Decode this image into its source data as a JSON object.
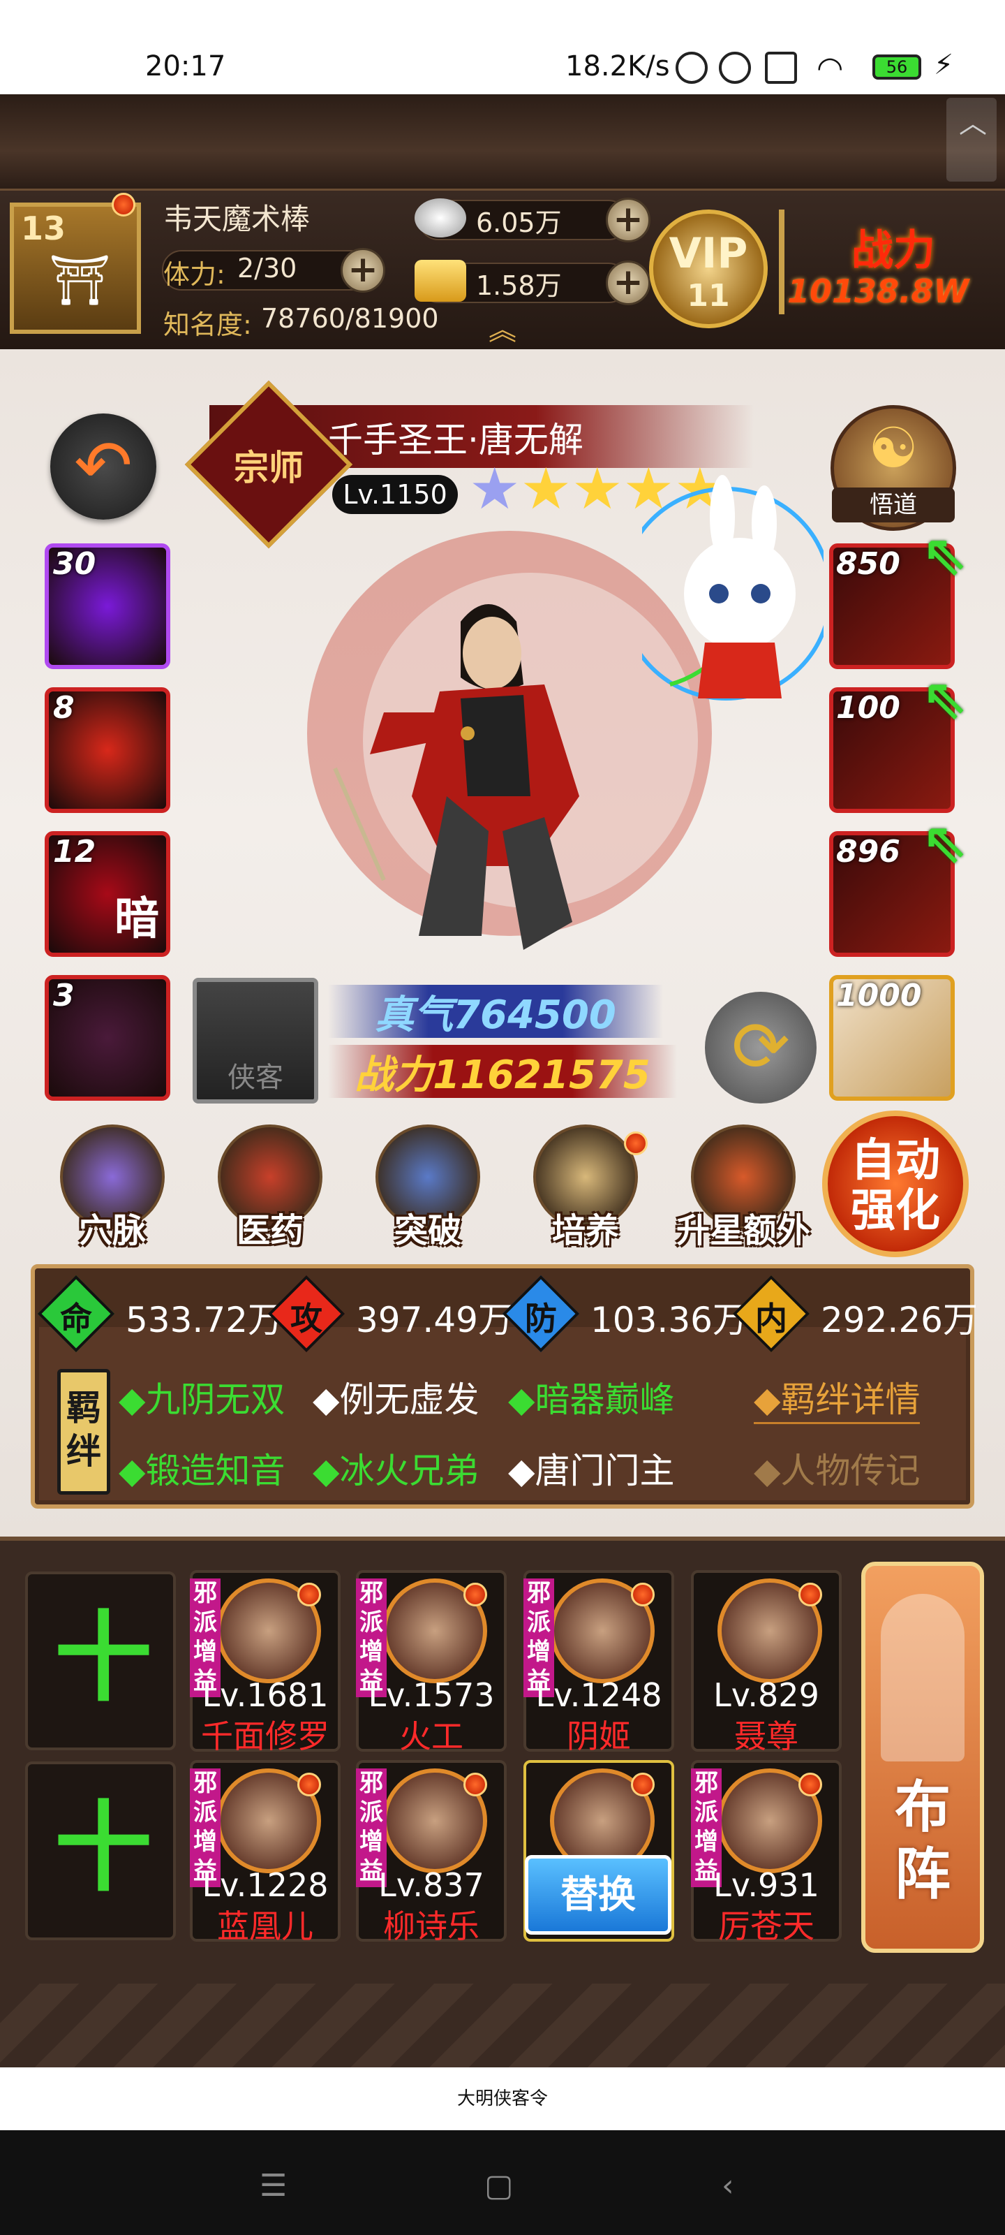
{
  "status_bar": {
    "time": "20:17",
    "speed": "18.2K/s",
    "battery": "56"
  },
  "player": {
    "level": "13",
    "name": "韦天魔术棒",
    "stamina_label": "体力:",
    "stamina_value": "2/30",
    "fame_label": "知名度:",
    "fame_value": "78760/81900",
    "silver": "6.05万",
    "gold": "1.58万",
    "vip_label": "VIP",
    "vip_level": "11",
    "power_label": "战力",
    "power_value": "10138.8W"
  },
  "hero": {
    "badge": "宗师",
    "title": "千手圣王·唐无解",
    "level": "Lv.1150",
    "stars": 5,
    "wudao_label": "悟道",
    "qi_label": "真气",
    "qi_value": "764500",
    "power_label": "战力",
    "power_value": "11621575",
    "xiake_label": "侠客"
  },
  "skills": [
    {
      "num": "30",
      "color": "#7a1ad8"
    },
    {
      "num": "8",
      "color": "#d8281a"
    },
    {
      "num": "12",
      "color": "#a80a18",
      "glyph": "暗"
    },
    {
      "num": "3",
      "color": "#4a1a3a"
    }
  ],
  "equipment": [
    {
      "num": "850",
      "upgrade": true
    },
    {
      "num": "100",
      "upgrade": true
    },
    {
      "num": "896",
      "upgrade": true
    },
    {
      "num": "1000",
      "upgrade": false
    }
  ],
  "actions": [
    {
      "label": "穴脉",
      "color": "#8a6ad8",
      "dot": false
    },
    {
      "label": "医药",
      "color": "#c8402a",
      "dot": false
    },
    {
      "label": "突破",
      "color": "#5a7ac8",
      "dot": false
    },
    {
      "label": "培养",
      "color": "#d8b87a",
      "dot": true
    },
    {
      "label": "升星额外",
      "color": "#d85a2a",
      "dot": false
    }
  ],
  "auto_strengthen": "自动强化",
  "stats": [
    {
      "glyph": "命",
      "value": "533.72万",
      "color": "#2ac83a"
    },
    {
      "glyph": "攻",
      "value": "397.49万",
      "color": "#e8281a"
    },
    {
      "glyph": "防",
      "value": "103.36万",
      "color": "#2a8ae8"
    },
    {
      "glyph": "内",
      "value": "292.26万",
      "color": "#e8a81a"
    }
  ],
  "bond_tag": "羁绊",
  "bonds_row1": [
    {
      "text": "◆九阴无双",
      "active": true
    },
    {
      "text": "◆例无虚发",
      "active": false
    },
    {
      "text": "◆暗器巅峰",
      "active": true
    }
  ],
  "bonds_row2": [
    {
      "text": "◆锻造知音",
      "active": true
    },
    {
      "text": "◆冰火兄弟",
      "active": true
    },
    {
      "text": "◆唐门门主",
      "active": false
    }
  ],
  "bond_detail": "◆羁绊详情",
  "biography": "◆人物传记",
  "add_slot": "十",
  "lineup_row1": [
    {
      "level": "Lv.1681",
      "name": "千面修罗",
      "tag": "邪派增益"
    },
    {
      "level": "Lv.1573",
      "name": "火工",
      "tag": "邪派增益"
    },
    {
      "level": "Lv.1248",
      "name": "阴姬",
      "tag": "邪派增益"
    },
    {
      "level": "Lv.829",
      "name": "聂尊",
      "tag": ""
    }
  ],
  "lineup_row2": [
    {
      "level": "Lv.1228",
      "name": "蓝凰儿",
      "tag": "邪派增益"
    },
    {
      "level": "Lv.837",
      "name": "柳诗乐",
      "tag": "邪派增益"
    },
    {
      "level": "",
      "name": "",
      "tag": "",
      "swap": "替换"
    },
    {
      "level": "Lv.931",
      "name": "厉苍天",
      "tag": "邪派增益"
    }
  ],
  "formation_btn": "布阵",
  "app_label": "大明侠客令"
}
